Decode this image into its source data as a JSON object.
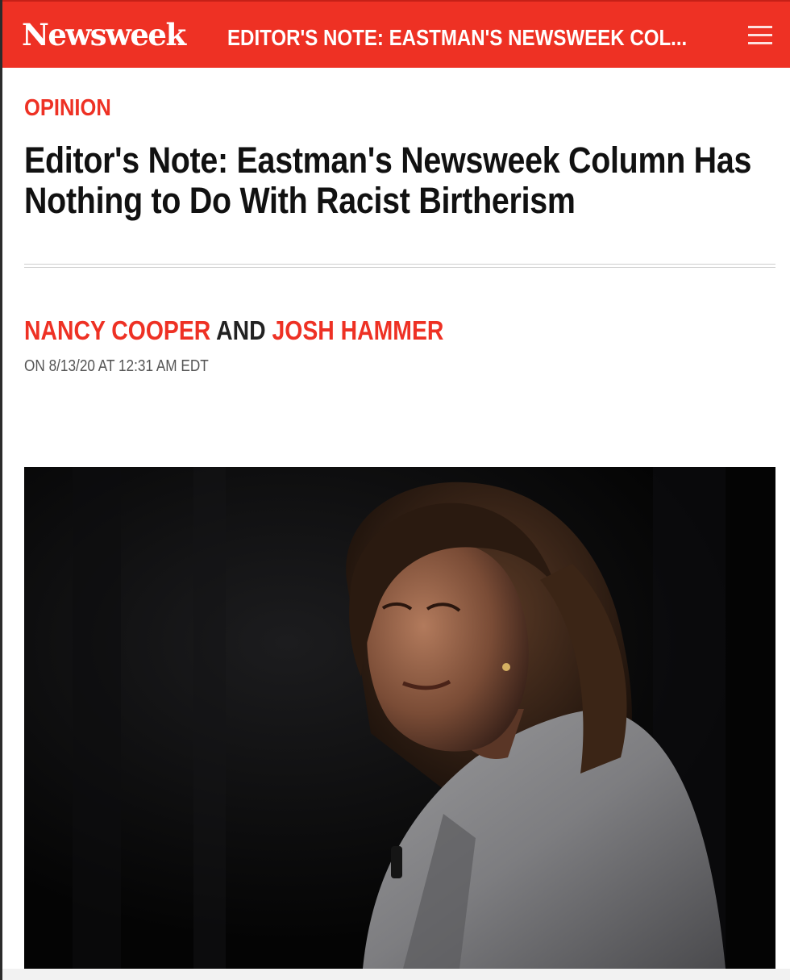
{
  "header": {
    "logo": "Newsweek",
    "title": "EDITOR'S NOTE: EASTMAN'S NEWSWEEK COL...",
    "menu_icon": "hamburger-menu-icon"
  },
  "article": {
    "section": "OPINION",
    "headline": "Editor's Note: Eastman's Newsweek Column Has Nothing to Do With Racist Birtherism",
    "authors": [
      "NANCY COOPER",
      "JOSH HAMMER"
    ],
    "author_joiner": "AND",
    "dateline": "ON 8/13/20 AT 12:31 AM EDT"
  },
  "colors": {
    "brand_red": "#ee3124",
    "headline_text": "#111111",
    "dateline_text": "#555555"
  }
}
